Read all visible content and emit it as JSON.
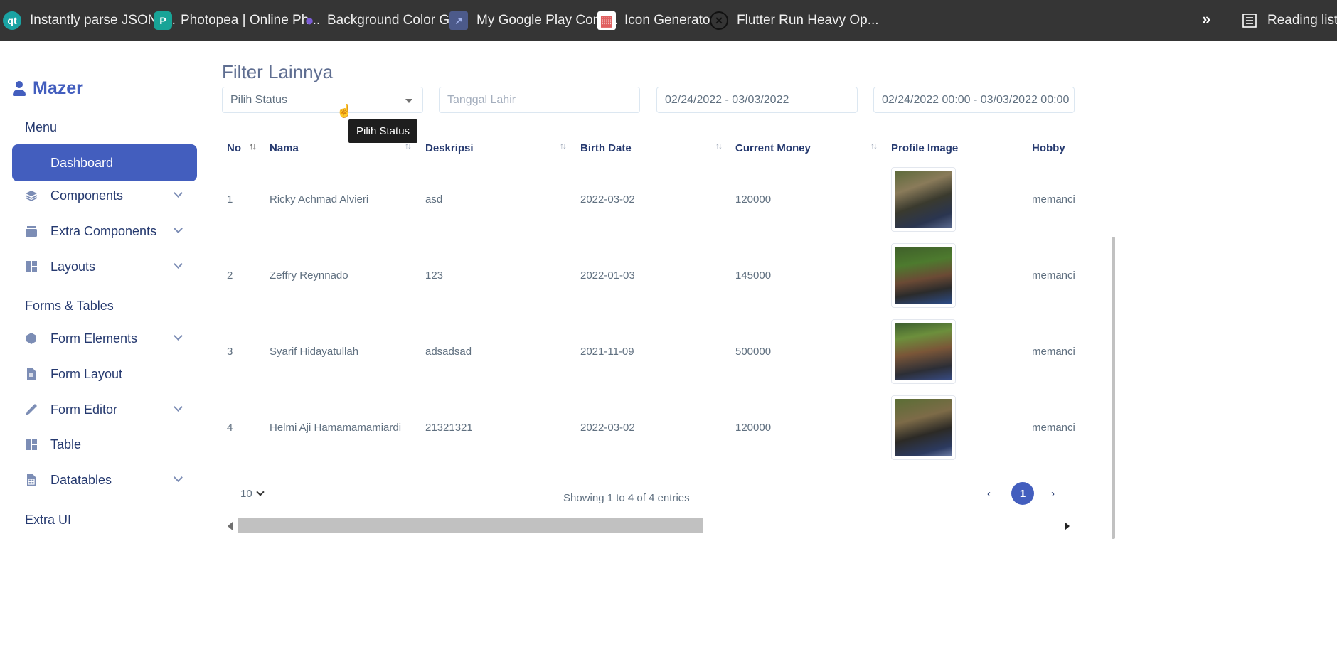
{
  "bookmarks": {
    "items": [
      {
        "label": "Instantly parse JSON i...",
        "icon": "qt-icon",
        "iconColor": "#1aa3a3",
        "iconText": "qt"
      },
      {
        "label": "Photopea | Online Ph...",
        "icon": "photopea-icon",
        "iconColor": "#18a497",
        "iconText": "P"
      },
      {
        "label": "Background Color Gr...",
        "icon": "planet-icon",
        "iconColor": "#7b5cd6",
        "iconText": "●"
      },
      {
        "label": "My Google Play Cons...",
        "icon": "chart-icon",
        "iconColor": "#6f7fbf",
        "iconText": "↗"
      },
      {
        "label": "Icon Generator",
        "icon": "grid-icon",
        "iconColor": "#e06060",
        "iconText": "▦"
      },
      {
        "label": "Flutter Run Heavy Op...",
        "icon": "x-icon",
        "iconColor": "#222222",
        "iconText": "✕"
      }
    ],
    "more": "»",
    "reading_list": "Reading list"
  },
  "sidebar": {
    "brand": "Mazer",
    "sections": {
      "menu": "Menu",
      "forms_tables": "Forms & Tables",
      "extra_ui": "Extra UI"
    },
    "items": [
      {
        "label": "Dashboard",
        "icon": "grid-icon",
        "active": true
      },
      {
        "label": "Components",
        "icon": "stack-icon",
        "expandable": true
      },
      {
        "label": "Extra Components",
        "icon": "collection-icon",
        "expandable": true
      },
      {
        "label": "Layouts",
        "icon": "layout-icon",
        "expandable": true
      },
      {
        "label": "Form Elements",
        "icon": "hexagon-icon",
        "expandable": true
      },
      {
        "label": "Form Layout",
        "icon": "file-text-icon"
      },
      {
        "label": "Form Editor",
        "icon": "pen-icon",
        "expandable": true
      },
      {
        "label": "Table",
        "icon": "table-layout-icon"
      },
      {
        "label": "Datatables",
        "icon": "file-spreadsheet-icon",
        "expandable": true
      }
    ],
    "accent": "#435ebe"
  },
  "filters": {
    "title": "Filter Lainnya",
    "status_select": "Pilih Status",
    "birth_placeholder": "Tanggal Lahir",
    "date_range": "02/24/2022 - 03/03/2022",
    "datetime_range": "02/24/2022 00:00 - 03/03/2022 00:00",
    "tooltip": "Pilih Status"
  },
  "table": {
    "columns": [
      "No",
      "Nama",
      "Deskripsi",
      "Birth Date",
      "Current Money",
      "Profile Image",
      "Hobby"
    ],
    "rows": [
      {
        "no": "1",
        "nama": "Ricky Achmad Alvieri",
        "deskripsi": "asd",
        "birth": "2022-03-02",
        "money": "120000",
        "hobby": "memancii"
      },
      {
        "no": "2",
        "nama": "Zeffry Reynnado",
        "deskripsi": "123",
        "birth": "2022-01-03",
        "money": "145000",
        "hobby": "memancii"
      },
      {
        "no": "3",
        "nama": "Syarif Hidayatullah",
        "deskripsi": "adsadsad",
        "birth": "2021-11-09",
        "money": "500000",
        "hobby": "memancii"
      },
      {
        "no": "4",
        "nama": "Helmi Aji Hamamamamiardi",
        "deskripsi": "21321321",
        "birth": "2022-03-02",
        "money": "120000",
        "hobby": "memancii"
      }
    ],
    "page_length": "10",
    "info": "Showing 1 to 4 of 4 entries",
    "pagination": {
      "prev": "‹",
      "current": "1",
      "next": "›"
    }
  }
}
